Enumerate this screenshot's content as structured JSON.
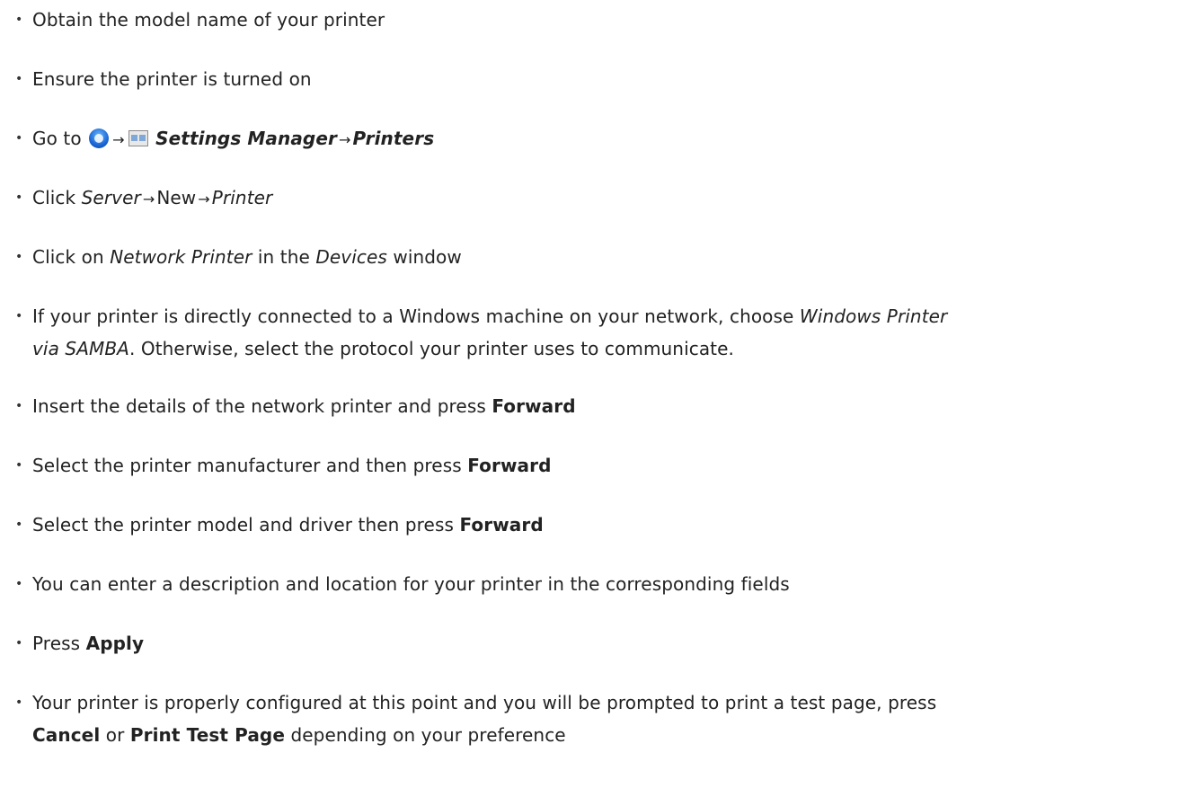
{
  "steps": [
    {
      "t1": "Obtain the model name of your printer"
    },
    {
      "t1": "Ensure the printer is turned on"
    },
    {
      "t1": "Go to ",
      "arrow": "→",
      "settings": "Settings Manager",
      "printers": "Printers"
    },
    {
      "t1": "Click ",
      "server": "Server",
      "arrow": "→",
      "new": "New",
      "printer": "Printer"
    },
    {
      "t1": "Click on ",
      "em1": "Network Printer",
      "t2": " in the ",
      "em2": "Devices",
      "t3": " window"
    },
    {
      "t1": "If your printer is directly connected to a Windows machine on your network, choose ",
      "em1": "Windows Printer",
      "em2": "via SAMBA",
      "t2": ". Otherwise, select the protocol your printer uses to communicate."
    },
    {
      "t1": "Insert the details of the network printer and press ",
      "b1": "Forward"
    },
    {
      "t1": "Select the printer manufacturer and then press ",
      "b1": "Forward"
    },
    {
      "t1": "Select the printer model and driver then press ",
      "b1": "Forward"
    },
    {
      "t1": "You can enter a description and location for your printer in the corresponding fields"
    },
    {
      "t1": "Press ",
      "b1": "Apply"
    },
    {
      "t1": "Your printer is properly configured at this point and you will be prompted to print a test page, press",
      "b1": "Cancel",
      "t2": " or ",
      "b2": "Print Test Page",
      "t3": " depending on your preference"
    }
  ],
  "icons": {
    "menu": "start-menu-icon",
    "settings": "settings-manager-icon"
  }
}
